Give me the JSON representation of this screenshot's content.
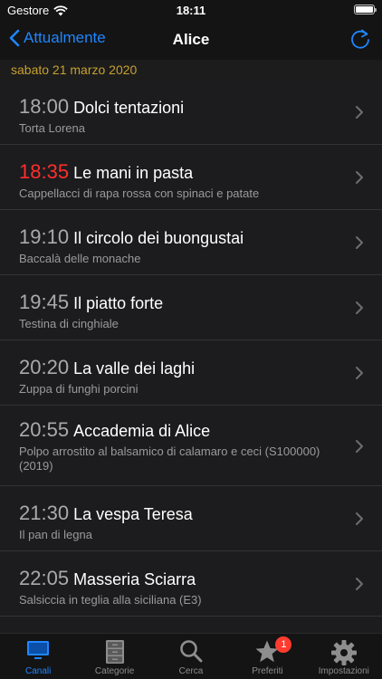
{
  "status": {
    "carrier": "Gestore",
    "time": "18:11"
  },
  "nav": {
    "back_label": "Attualmente",
    "title": "Alice"
  },
  "date_header": "sabato 21 marzo 2020",
  "programs": [
    {
      "time": "18:00",
      "title": "Dolci tentazioni",
      "subtitle": "Torta Lorena",
      "current": false
    },
    {
      "time": "18:35",
      "title": "Le mani in pasta",
      "subtitle": "Cappellacci di rapa rossa con spinaci e patate",
      "current": true
    },
    {
      "time": "19:10",
      "title": "Il circolo dei buongustai",
      "subtitle": "Baccalà delle monache",
      "current": false
    },
    {
      "time": "19:45",
      "title": "Il piatto forte",
      "subtitle": "Testina di cinghiale",
      "current": false
    },
    {
      "time": "20:20",
      "title": "La valle dei laghi",
      "subtitle": "Zuppa di funghi porcini",
      "current": false
    },
    {
      "time": "20:55",
      "title": "Accademia di Alice",
      "subtitle": "Polpo arrostito al balsamico di calamaro e ceci (S100000) (2019)",
      "current": false
    },
    {
      "time": "21:30",
      "title": "La vespa Teresa",
      "subtitle": "Il pan di legna",
      "current": false
    },
    {
      "time": "22:05",
      "title": "Masseria Sciarra",
      "subtitle": "Salsiccia in teglia alla siciliana (E3)",
      "current": false
    }
  ],
  "tabs": [
    {
      "label": "Canali",
      "icon": "tv-icon",
      "active": true
    },
    {
      "label": "Categorie",
      "icon": "cabinet-icon",
      "active": false
    },
    {
      "label": "Cerca",
      "icon": "search-icon",
      "active": false
    },
    {
      "label": "Preferiti",
      "icon": "star-icon",
      "active": false,
      "badge": "1"
    },
    {
      "label": "Impostazioni",
      "icon": "gear-icon",
      "active": false
    }
  ],
  "colors": {
    "accent": "#1f86ff",
    "now": "#ff2d2d",
    "date": "#c7a030",
    "badge": "#ff3b30"
  }
}
